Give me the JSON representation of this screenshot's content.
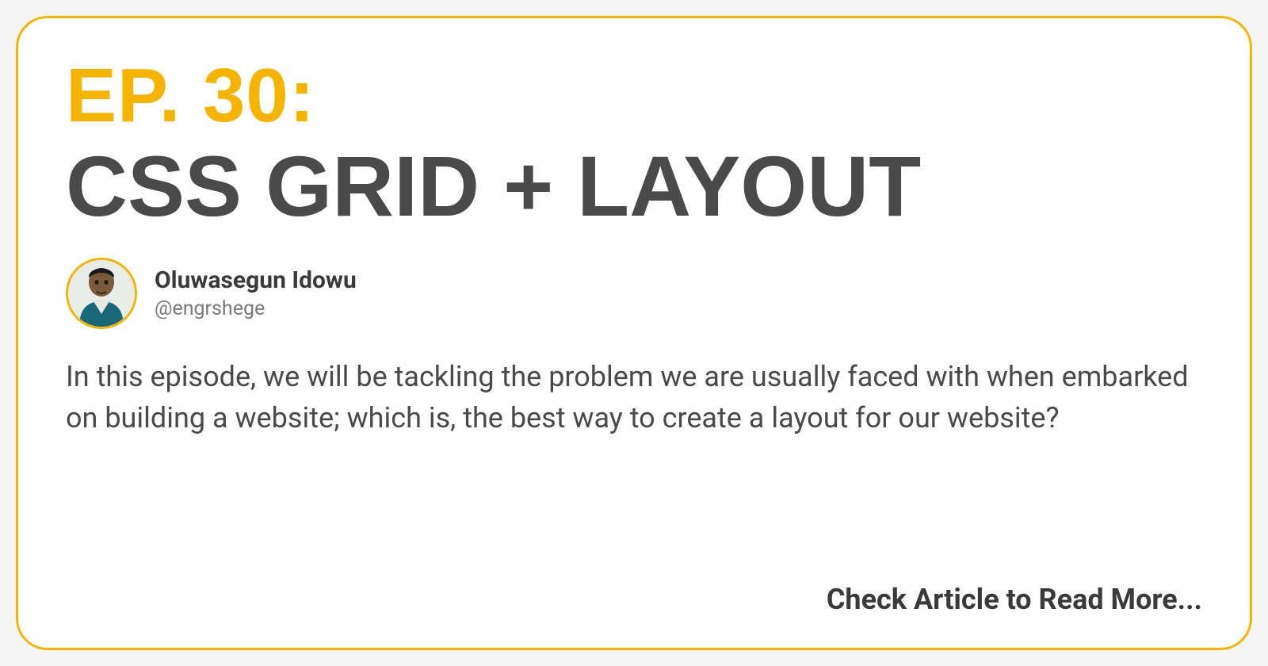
{
  "episode": {
    "label": "EP. 30:",
    "title": "CSS GRID + LAYOUT"
  },
  "author": {
    "name": "Oluwasegun Idowu",
    "handle": "@engrshege"
  },
  "description": "In this episode, we will be tackling the problem we are usually faced with when embarked on building a website; which is, the best way to create a layout for our website?",
  "readMore": "Check Article to Read More...",
  "colors": {
    "accent": "#f5b400",
    "text_dark": "#4a4a4a",
    "text_muted": "#7a7a7a"
  }
}
